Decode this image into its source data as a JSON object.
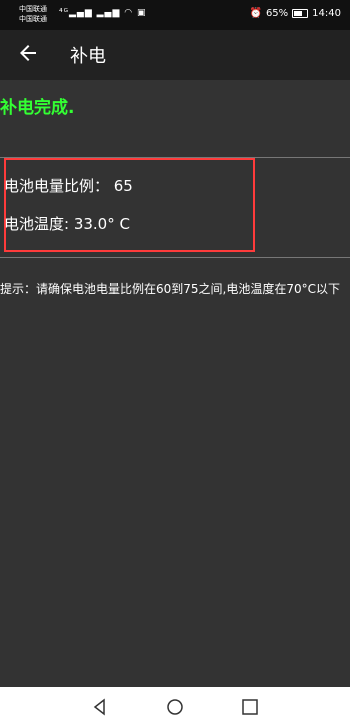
{
  "status_bar": {
    "carrier_1": "中国联通",
    "carrier_2": "中国联通",
    "battery_percent": "65%",
    "battery_level": 0.65,
    "time": "14:40",
    "icons": [
      "signal-4g-icon",
      "signal-icon",
      "wifi-icon",
      "message-icon",
      "alarm-icon",
      "battery-icon"
    ]
  },
  "toolbar": {
    "title": "补电"
  },
  "main": {
    "complete_text": "补电完成.",
    "complete_color": "#33ff33",
    "battery_ratio_line": "电池电量比例： 65",
    "battery_temp_line": "电池温度: 33.0° C",
    "tip": "提示：请确保电池电量比例在60到75之间,电池温度在70°C以下"
  },
  "nav_bar": {
    "icons": [
      "nav-back-icon",
      "nav-home-icon",
      "nav-recent-icon"
    ]
  }
}
